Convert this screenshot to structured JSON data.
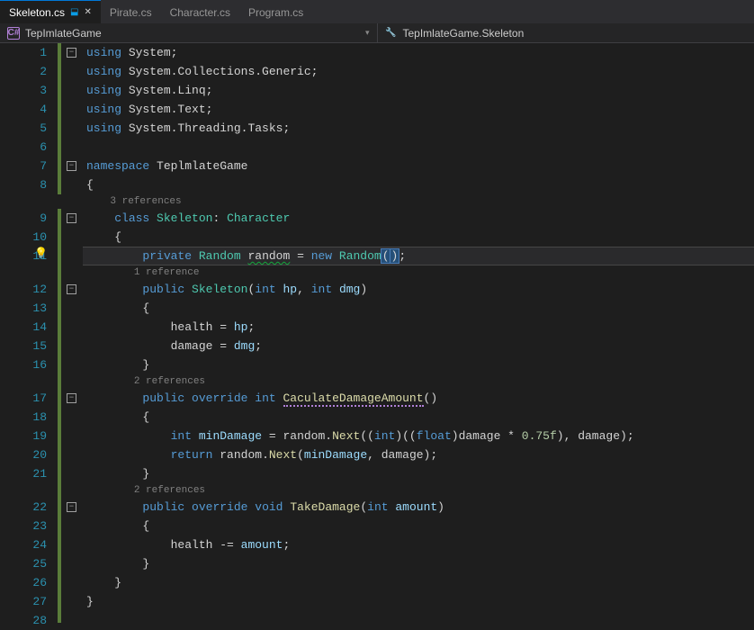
{
  "tabs": [
    {
      "label": "Skeleton.cs",
      "active": true,
      "pinned": true
    },
    {
      "label": "Pirate.cs",
      "active": false
    },
    {
      "label": "Character.cs",
      "active": false
    },
    {
      "label": "Program.cs",
      "active": false
    }
  ],
  "nav": {
    "project": "TepImlateGame",
    "class": "TepImlateGame.Skeleton"
  },
  "refs": {
    "class": "3 references",
    "ctor": "1 reference",
    "calc": "2 references",
    "take": "2 references"
  },
  "kw": {
    "using": "using",
    "namespace": "namespace",
    "class": "class",
    "private": "private",
    "new": "new",
    "public": "public",
    "int": "int",
    "override": "override",
    "void": "void",
    "return": "return",
    "float": "float"
  },
  "code": {
    "system": "System",
    "collections": "System.Collections.Generic",
    "linq": "System.Linq",
    "text": "System.Text",
    "threading": "System.Threading.Tasks",
    "nsName": "TeplmlateGame",
    "className": "Skeleton",
    "baseClass": "Character",
    "randomType": "Random",
    "randomField": "random",
    "ctorName": "Skeleton",
    "hp": "hp",
    "dmg": "dmg",
    "health": "health",
    "damage": "damage",
    "calcMethod": "CaculateDamageAmount",
    "minDamage": "minDamage",
    "next": "Next",
    "factor": "0.75f",
    "takeMethod": "TakeDamage",
    "amount": "amount"
  },
  "lineNumbers": [
    "1",
    "2",
    "3",
    "4",
    "5",
    "6",
    "7",
    "8",
    "9",
    "10",
    "11",
    "12",
    "13",
    "14",
    "15",
    "16",
    "17",
    "18",
    "19",
    "20",
    "21",
    "22",
    "23",
    "24",
    "25",
    "26",
    "27",
    "28"
  ]
}
